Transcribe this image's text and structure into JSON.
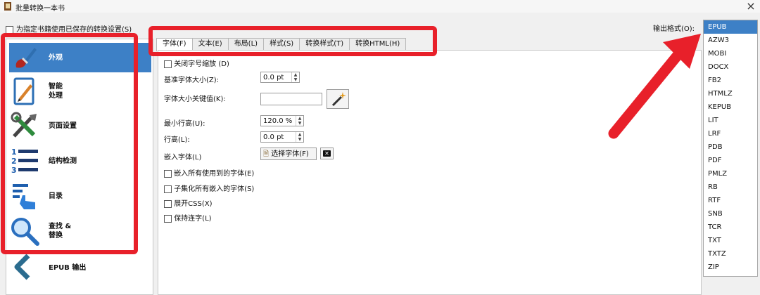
{
  "window": {
    "title": "批量转换一本书"
  },
  "top": {
    "use_saved_label": "为指定书籍使用已保存的转换设置(S)"
  },
  "sidebar": {
    "items": [
      {
        "label": "外观",
        "icon": "paintbrush-icon",
        "active": true
      },
      {
        "label": "智能\n处理",
        "icon": "heuristics-icon"
      },
      {
        "label": "页面设置",
        "icon": "page-setup-icon"
      },
      {
        "label": "结构检测",
        "icon": "structure-icon"
      },
      {
        "label": "目录",
        "icon": "toc-icon"
      },
      {
        "label": "查找 &\n替换",
        "icon": "magnifier-icon"
      },
      {
        "label": "EPUB 输出",
        "icon": "epub-output-icon"
      }
    ]
  },
  "tabs": [
    "字体(F)",
    "文本(E)",
    "布局(L)",
    "样式(S)",
    "转换样式(T)",
    "转换HTML(H)"
  ],
  "form": {
    "disable_font_rescale": "关闭字号缩放 (D)",
    "base_font_label": "基准字体大小(Z):",
    "base_font_value": "0.0 pt",
    "font_key_label": "字体大小关键值(K):",
    "font_key_value": "",
    "min_line_height_label": "最小行高(U):",
    "min_line_height_value": "120.0 %",
    "line_height_label": "行高(L):",
    "line_height_value": "0.0 pt",
    "embed_font_label": "嵌入字体(L)",
    "choose_font_label": "选择字体(F)",
    "embed_all_fonts": "嵌入所有使用到的字体(E)",
    "subset_fonts": "子集化所有嵌入的字体(S)",
    "expand_css": "展开CSS(X)",
    "keep_ligatures": "保持连字(L)"
  },
  "output": {
    "label": "输出格式(O):",
    "formats": [
      "EPUB",
      "AZW3",
      "MOBI",
      "DOCX",
      "FB2",
      "HTMLZ",
      "KEPUB",
      "LIT",
      "LRF",
      "PDB",
      "PDF",
      "PMLZ",
      "RB",
      "RTF",
      "SNB",
      "TCR",
      "TXT",
      "TXTZ",
      "ZIP"
    ],
    "selected": "EPUB"
  },
  "colors": {
    "accent": "#3d80c6",
    "annotation": "#e8202a"
  }
}
